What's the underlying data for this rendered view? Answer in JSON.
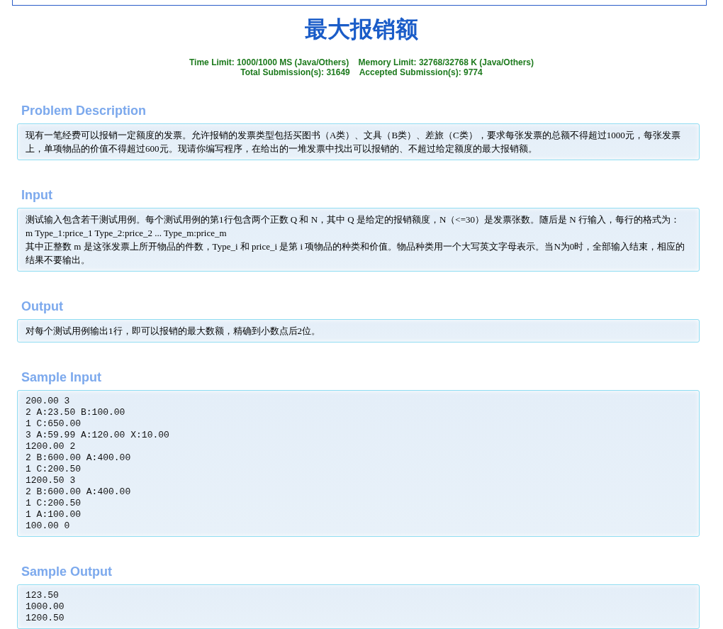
{
  "title": "最大报销额",
  "limits": [
    "Time Limit: 1000/1000 MS (Java/Others)    Memory Limit: 32768/32768 K (Java/Others)",
    "Total Submission(s): 31649    Accepted Submission(s): 9774"
  ],
  "sections": [
    {
      "heading": "Problem Description",
      "kind": "text",
      "lines": [
        "现有一笔经费可以报销一定额度的发票。允许报销的发票类型包括买图书（A类）、文具（B类）、差旅（C类），要求每张发票的总额不得超过1000元，每张发票上，单项物品的价值不得超过600元。现请你编写程序，在给出的一堆发票中找出可以报销的、不超过给定额度的最大报销额。"
      ]
    },
    {
      "heading": "Input",
      "kind": "text",
      "lines": [
        "测试输入包含若干测试用例。每个测试用例的第1行包含两个正数 Q 和 N，其中 Q 是给定的报销额度，N（<=30）是发票张数。随后是 N 行输入，每行的格式为：",
        "m Type_1:price_1 Type_2:price_2 ... Type_m:price_m",
        "其中正整数 m 是这张发票上所开物品的件数，Type_i 和 price_i 是第 i 项物品的种类和价值。物品种类用一个大写英文字母表示。当N为0时，全部输入结束，相应的结果不要输出。"
      ]
    },
    {
      "heading": "Output",
      "kind": "text",
      "lines": [
        "对每个测试用例输出1行，即可以报销的最大数额，精确到小数点后2位。"
      ]
    },
    {
      "heading": "Sample Input",
      "kind": "code",
      "lines": [
        "200.00 3",
        "2 A:23.50 B:100.00",
        "1 C:650.00",
        "3 A:59.99 A:120.00 X:10.00",
        "1200.00 2",
        "2 B:600.00 A:400.00",
        "1 C:200.50",
        "1200.50 3",
        "2 B:600.00 A:400.00",
        "1 C:200.50",
        "1 A:100.00",
        "100.00 0"
      ]
    },
    {
      "heading": "Sample Output",
      "kind": "code",
      "lines": [
        "123.50",
        "1000.00",
        "1200.50"
      ]
    }
  ]
}
